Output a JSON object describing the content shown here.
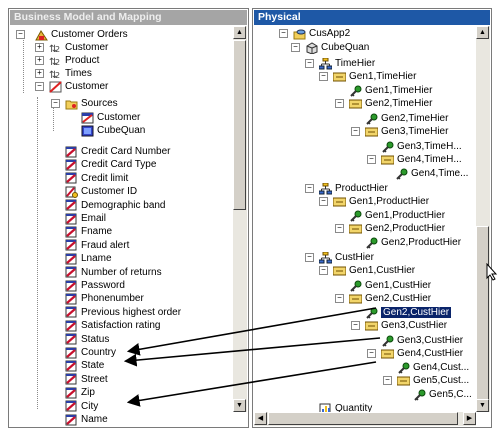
{
  "left_pane": {
    "title": "Business Model and Mapping",
    "items": [
      {
        "label": "Customer Orders",
        "icon": "business-model-icon"
      },
      {
        "label": "Customer",
        "icon": "logical-table-icon"
      },
      {
        "label": "Product",
        "icon": "logical-table-icon"
      },
      {
        "label": "Times",
        "icon": "logical-table-icon"
      },
      {
        "label": "Customer",
        "icon": "logical-table-icon"
      },
      {
        "label": "Sources",
        "icon": "folder-icon"
      },
      {
        "label": "Customer",
        "icon": "source-table-icon"
      },
      {
        "label": "CubeQuan",
        "icon": "source-table-icon"
      },
      {
        "label": "Credit Card Number",
        "icon": "column-icon"
      },
      {
        "label": "Credit Card Type",
        "icon": "column-icon"
      },
      {
        "label": "Credit limit",
        "icon": "column-icon"
      },
      {
        "label": "Customer ID",
        "icon": "key-column-icon"
      },
      {
        "label": "Demographic band",
        "icon": "column-icon"
      },
      {
        "label": "Email",
        "icon": "column-icon"
      },
      {
        "label": "Fname",
        "icon": "column-icon"
      },
      {
        "label": "Fraud alert",
        "icon": "column-icon"
      },
      {
        "label": "Lname",
        "icon": "column-icon"
      },
      {
        "label": "Number of returns",
        "icon": "column-icon"
      },
      {
        "label": "Password",
        "icon": "column-icon"
      },
      {
        "label": "Phonenumber",
        "icon": "column-icon"
      },
      {
        "label": "Previous highest order",
        "icon": "column-icon"
      },
      {
        "label": "Satisfaction rating",
        "icon": "column-icon"
      },
      {
        "label": "Status",
        "icon": "column-icon"
      },
      {
        "label": "Country",
        "icon": "column-icon"
      },
      {
        "label": "State",
        "icon": "column-icon"
      },
      {
        "label": "Street",
        "icon": "column-icon"
      },
      {
        "label": "Zip",
        "icon": "column-icon"
      },
      {
        "label": "City",
        "icon": "column-icon"
      },
      {
        "label": "Name",
        "icon": "column-icon"
      }
    ]
  },
  "right_pane": {
    "title": "Physical",
    "items": [
      {
        "label": "CusApp2",
        "icon": "database-icon"
      },
      {
        "label": "CubeQuan",
        "icon": "cube-icon"
      },
      {
        "label": "TimeHier",
        "icon": "hierarchy-icon"
      },
      {
        "label": "Gen1,TimeHier",
        "icon": "level-icon"
      },
      {
        "label": "Gen1,TimeHier",
        "icon": "key-icon"
      },
      {
        "label": "Gen2,TimeHier",
        "icon": "level-icon"
      },
      {
        "label": "Gen2,TimeHier",
        "icon": "key-icon"
      },
      {
        "label": "Gen3,TimeHier",
        "icon": "level-icon"
      },
      {
        "label": "Gen3,TimeH...",
        "icon": "key-icon"
      },
      {
        "label": "Gen4,TimeH...",
        "icon": "level-icon"
      },
      {
        "label": "Gen4,Time...",
        "icon": "key-icon"
      },
      {
        "label": "ProductHier",
        "icon": "hierarchy-icon"
      },
      {
        "label": "Gen1,ProductHier",
        "icon": "level-icon"
      },
      {
        "label": "Gen1,ProductHier",
        "icon": "key-icon"
      },
      {
        "label": "Gen2,ProductHier",
        "icon": "level-icon"
      },
      {
        "label": "Gen2,ProductHier",
        "icon": "key-icon"
      },
      {
        "label": "CustHier",
        "icon": "hierarchy-icon"
      },
      {
        "label": "Gen1,CustHier",
        "icon": "level-icon"
      },
      {
        "label": "Gen1,CustHier",
        "icon": "key-icon"
      },
      {
        "label": "Gen2,CustHier",
        "icon": "level-icon"
      },
      {
        "label": "Gen2,CustHier",
        "icon": "key-icon",
        "selected": true
      },
      {
        "label": "Gen3,CustHier",
        "icon": "level-icon"
      },
      {
        "label": "Gen3,CustHier",
        "icon": "key-icon"
      },
      {
        "label": "Gen4,CustHier",
        "icon": "level-icon"
      },
      {
        "label": "Gen4,Cust...",
        "icon": "key-icon"
      },
      {
        "label": "Gen5,Cust...",
        "icon": "level-icon"
      },
      {
        "label": "Gen5,C...",
        "icon": "key-icon"
      },
      {
        "label": "Quantity",
        "icon": "measure-icon"
      }
    ]
  },
  "colors": {
    "active_title": "#1e58a6",
    "inactive_title": "#a5a5a5",
    "selection": "#0a246a",
    "column_icon_red": "#c8102e",
    "key_icon_green": "#2c9a2c"
  }
}
